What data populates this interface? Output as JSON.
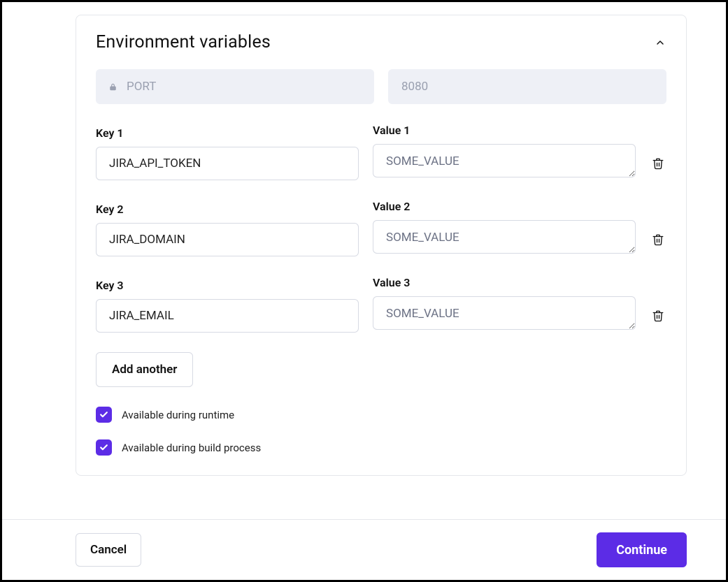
{
  "panel": {
    "title": "Environment variables",
    "example": {
      "key_placeholder": "PORT",
      "value_placeholder": "8080"
    },
    "rows": [
      {
        "key_label": "Key 1",
        "value_label": "Value 1",
        "key": "JIRA_API_TOKEN",
        "value": "SOME_VALUE"
      },
      {
        "key_label": "Key 2",
        "value_label": "Value 2",
        "key": "JIRA_DOMAIN",
        "value": "SOME_VALUE"
      },
      {
        "key_label": "Key 3",
        "value_label": "Value 3",
        "key": "JIRA_EMAIL",
        "value": "SOME_VALUE"
      }
    ],
    "add_button": "Add another",
    "checkbox_runtime": "Available during runtime",
    "checkbox_build": "Available during build process"
  },
  "footer": {
    "cancel": "Cancel",
    "continue": "Continue"
  },
  "colors": {
    "accent": "#5c2ce6"
  }
}
